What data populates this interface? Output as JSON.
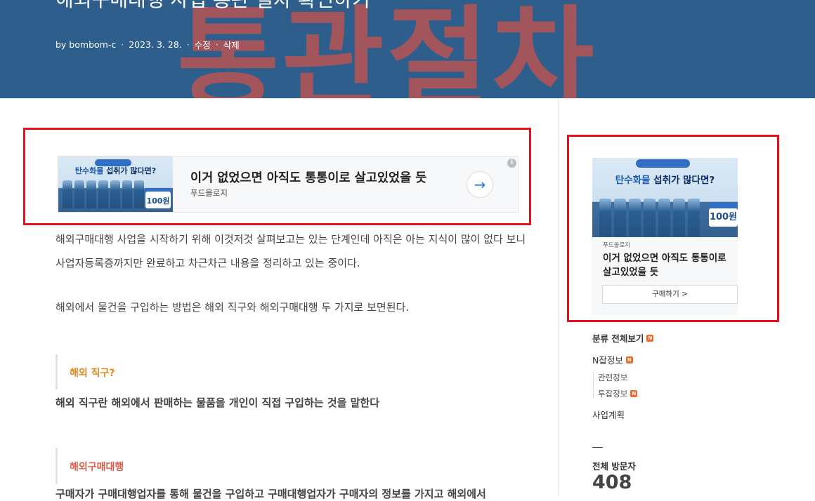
{
  "post": {
    "title": "해외구매대행 사업 통관 절차 확인하기",
    "hero_image_text": "통관절차",
    "meta": {
      "author": "by bombom-c",
      "date": "2023. 3. 28.",
      "edit": "수정",
      "delete": "삭제",
      "separator": "·"
    }
  },
  "main_ad": {
    "title": "이거 없었으면 아직도 통통이로 살고있었을 듯",
    "sponsor": "푸드올로지",
    "image_headline_a": "탄수화물 ",
    "image_headline_b": "섭취가 많다면?",
    "image_price": "100원",
    "arrow_icon": "→",
    "info_icon": "i"
  },
  "content": {
    "paragraph_1": "해외구매대행 사업을 시작하기 위해 이것저것 살펴보고는 있는 단계인데 아직은 아는 지식이 많이 없다 보니 사업자등록증까지만 완료하고 차근차근 내용을 정리하고 있는 중이다.",
    "paragraph_2": "해외에서 물건을 구입하는 방법은 해외 직구와 해외구매대행 두 가지로 보면된다.",
    "quote_1": "해외 직구?",
    "bold_1": "해외 직구란 해외에서 판매하는 물품을 개인이 직접 구입하는 것을 말한다",
    "quote_2": "해외구매대행",
    "bold_2": "구매자가 구매대행업자를 통해 물건을 구입하고 구매대행업자가 구매자의 정보를 가지고 해외에서"
  },
  "side_ad": {
    "image_headline_a": "탄수화물 ",
    "image_headline_b": "섭취가 많다면?",
    "image_price": "100원",
    "sponsor": "푸드올로지",
    "title": "이거 없었으면 아직도 통통이로 살고있었을 듯",
    "button": "구매하기 >"
  },
  "sidebar": {
    "categories": [
      {
        "label": "분류 전체보기",
        "new": true
      },
      {
        "label": "N잡정보",
        "new": true
      },
      {
        "label": "관련정보",
        "new": false
      },
      {
        "label": "투잡정보",
        "new": true
      },
      {
        "label": "사업계획",
        "new": false
      }
    ],
    "new_badge": "N",
    "visitor_label": "전체 방문자",
    "visitor_count": "408"
  },
  "colors": {
    "hero_bg": "#2e5e8c",
    "hero_text_overlay": "#a2565c",
    "highlight_border": "#e8101a",
    "quote_1_color": "#e3871c",
    "quote_2_color": "#e05b4a",
    "new_badge": "#f0692c"
  }
}
